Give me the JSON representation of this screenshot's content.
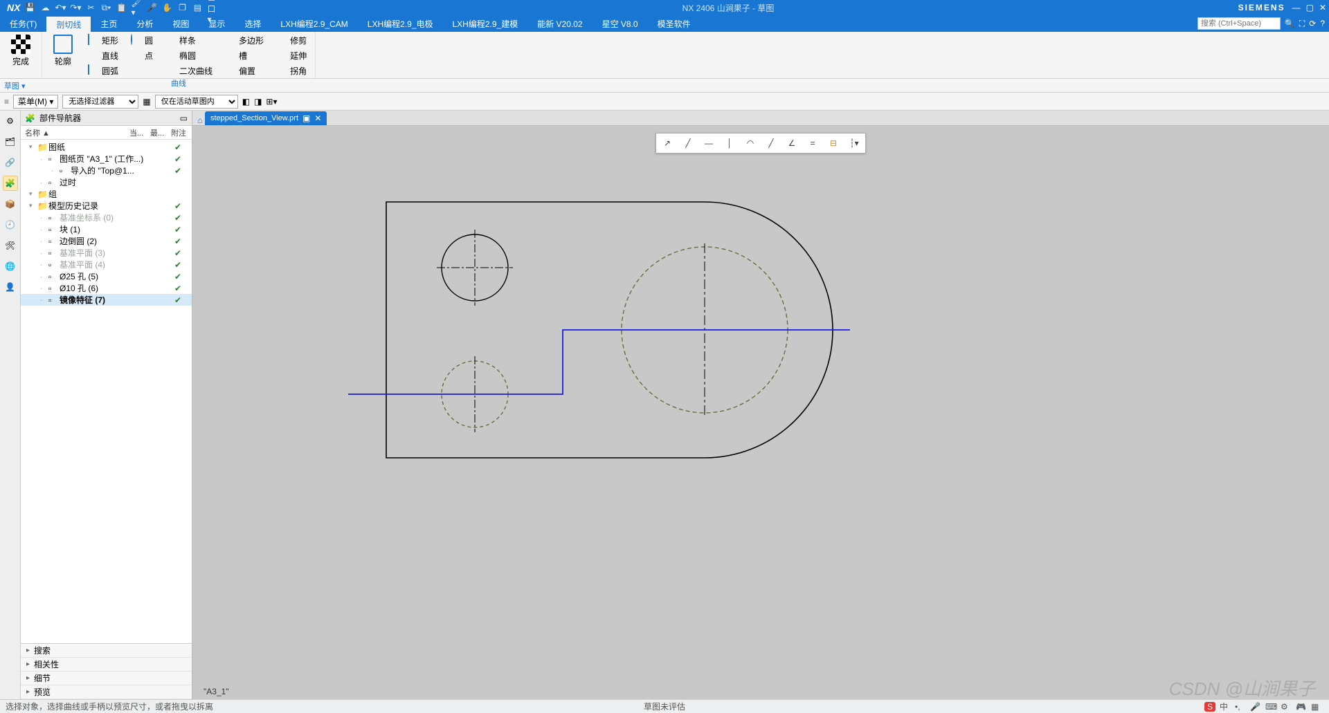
{
  "app": {
    "logo": "NX",
    "title": "NX 2406 山涧果子 - 草图",
    "brand": "SIEMENS"
  },
  "menus": [
    "任务(T)",
    "剖切线",
    "主页",
    "分析",
    "视图",
    "显示",
    "选择",
    "LXH编程2.9_CAM",
    "LXH编程2.9_电极",
    "LXH编程2.9_建模",
    "能新 V20.02",
    "星空 V8.0",
    "模圣软件"
  ],
  "active_menu_index": 1,
  "search_placeholder": "搜索 (Ctrl+Space)",
  "ribbon": {
    "finish": "完成",
    "profile": "轮廓",
    "curves_label": "曲线",
    "row1": [
      "矩形",
      "圆",
      "样条",
      "多边形",
      "修剪"
    ],
    "row2": [
      "直线",
      "点",
      "椭圆",
      "槽",
      "延伸"
    ],
    "row3": [
      "圆弧",
      "",
      "二次曲线",
      "偏置",
      "拐角"
    ]
  },
  "crumb": "草图 ▾",
  "filter": {
    "menu": "菜单(M) ▾",
    "combo1": "无选择过滤器",
    "combo2": "仅在活动草图内"
  },
  "nav": {
    "title": "部件导航器",
    "cols": [
      "名称 ▲",
      "当...",
      "最...",
      "附注"
    ],
    "tree": [
      {
        "depth": 0,
        "label": "图纸",
        "chk": true
      },
      {
        "depth": 1,
        "label": "图纸页 \"A3_1\" (工作...)",
        "chk": true
      },
      {
        "depth": 2,
        "label": "导入的 \"Top@1...",
        "chk": true
      },
      {
        "depth": 1,
        "label": "过时",
        "chk": false
      },
      {
        "depth": 0,
        "label": "组",
        "chk": false
      },
      {
        "depth": 0,
        "label": "模型历史记录",
        "chk": true
      },
      {
        "depth": 1,
        "label": "基准坐标系 (0)",
        "chk": true,
        "dim": true
      },
      {
        "depth": 1,
        "label": "块 (1)",
        "chk": true
      },
      {
        "depth": 1,
        "label": "边倒圆 (2)",
        "chk": true
      },
      {
        "depth": 1,
        "label": "基准平面 (3)",
        "chk": true,
        "dim": true
      },
      {
        "depth": 1,
        "label": "基准平面 (4)",
        "chk": true,
        "dim": true
      },
      {
        "depth": 1,
        "label": "Ø25 孔 (5)",
        "chk": true
      },
      {
        "depth": 1,
        "label": "Ø10 孔 (6)",
        "chk": true
      },
      {
        "depth": 1,
        "label": "镜像特征 (7)",
        "chk": true,
        "sel": true,
        "bold": true
      }
    ],
    "accordion": [
      "搜索",
      "相关性",
      "细节",
      "预览"
    ]
  },
  "tab": {
    "name": "stepped_Section_View.prt"
  },
  "sheet_label": "\"A3_1\"",
  "status": {
    "left": "选择对象，选择曲线或手柄以预览尺寸，或者拖曳以拆离",
    "center": "草图未评估"
  },
  "watermark": "CSDN @山涧果子"
}
